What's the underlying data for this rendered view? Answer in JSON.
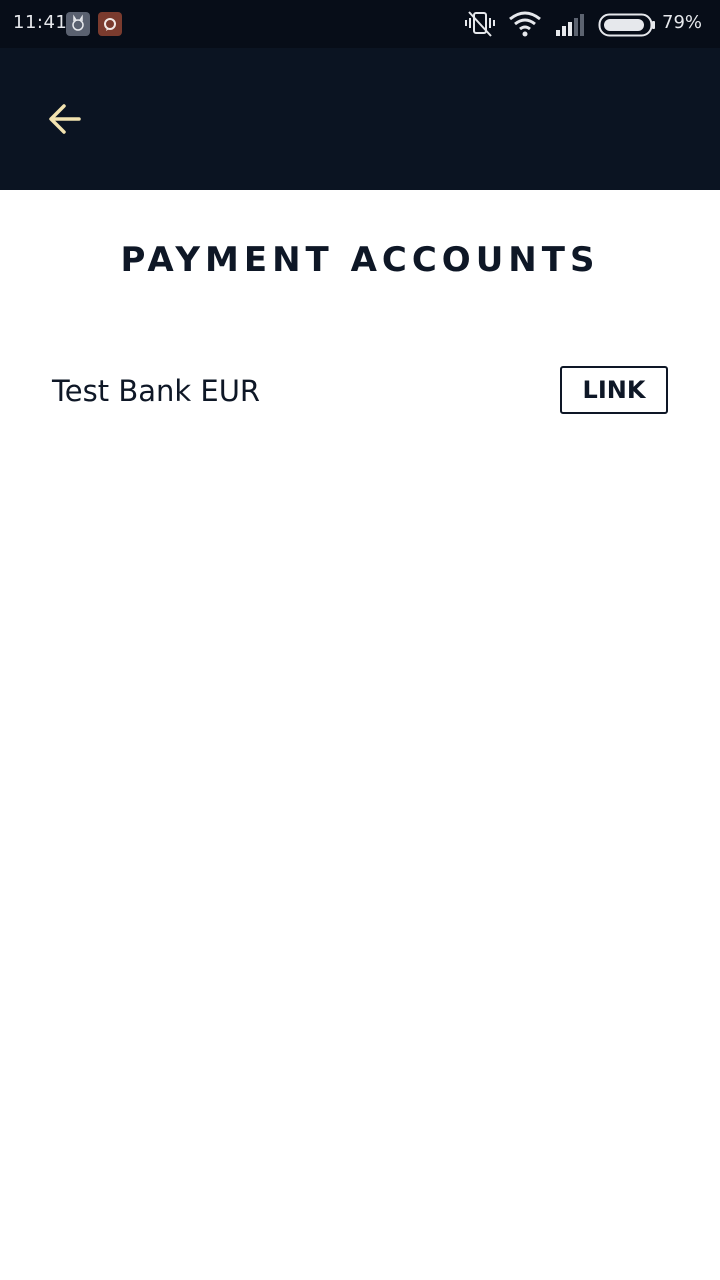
{
  "status_bar": {
    "time": "11:41",
    "battery_percent": "79%",
    "icons": [
      "cat-notification-icon",
      "chat-notification-icon",
      "vibrate-off-icon",
      "wifi-icon",
      "signal-icon",
      "battery-icon"
    ]
  },
  "app_bar": {
    "back_icon": "arrow-left-icon",
    "colors": {
      "background": "#0b1422",
      "icon": "#f3e3b0"
    }
  },
  "page": {
    "title": "PAYMENT ACCOUNTS"
  },
  "accounts": [
    {
      "name": "Test Bank EUR",
      "action_label": "LINK"
    }
  ]
}
